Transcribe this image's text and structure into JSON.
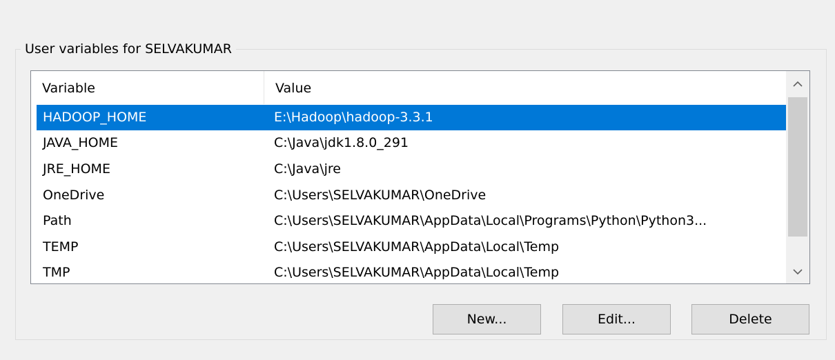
{
  "group": {
    "title": "User variables for SELVAKUMAR"
  },
  "list": {
    "columns": {
      "variable": "Variable",
      "value": "Value"
    },
    "rows": [
      {
        "variable": "HADOOP_HOME",
        "value": "E:\\Hadoop\\hadoop-3.3.1",
        "selected": true
      },
      {
        "variable": "JAVA_HOME",
        "value": "C:\\Java\\jdk1.8.0_291",
        "selected": false
      },
      {
        "variable": "JRE_HOME",
        "value": "C:\\Java\\jre",
        "selected": false
      },
      {
        "variable": "OneDrive",
        "value": "C:\\Users\\SELVAKUMAR\\OneDrive",
        "selected": false
      },
      {
        "variable": "Path",
        "value": "C:\\Users\\SELVAKUMAR\\AppData\\Local\\Programs\\Python\\Python3...",
        "selected": false
      },
      {
        "variable": "TEMP",
        "value": "C:\\Users\\SELVAKUMAR\\AppData\\Local\\Temp",
        "selected": false
      },
      {
        "variable": "TMP",
        "value": "C:\\Users\\SELVAKUMAR\\AppData\\Local\\Temp",
        "selected": false
      }
    ],
    "scroll_up_icon": "chevron-up-icon",
    "scroll_down_icon": "chevron-down-icon"
  },
  "buttons": {
    "new_label": "New...",
    "edit_label": "Edit...",
    "delete_label": "Delete"
  },
  "colors": {
    "selection": "#0078d7",
    "background": "#f0f0f0",
    "button_face": "#e1e1e1"
  }
}
